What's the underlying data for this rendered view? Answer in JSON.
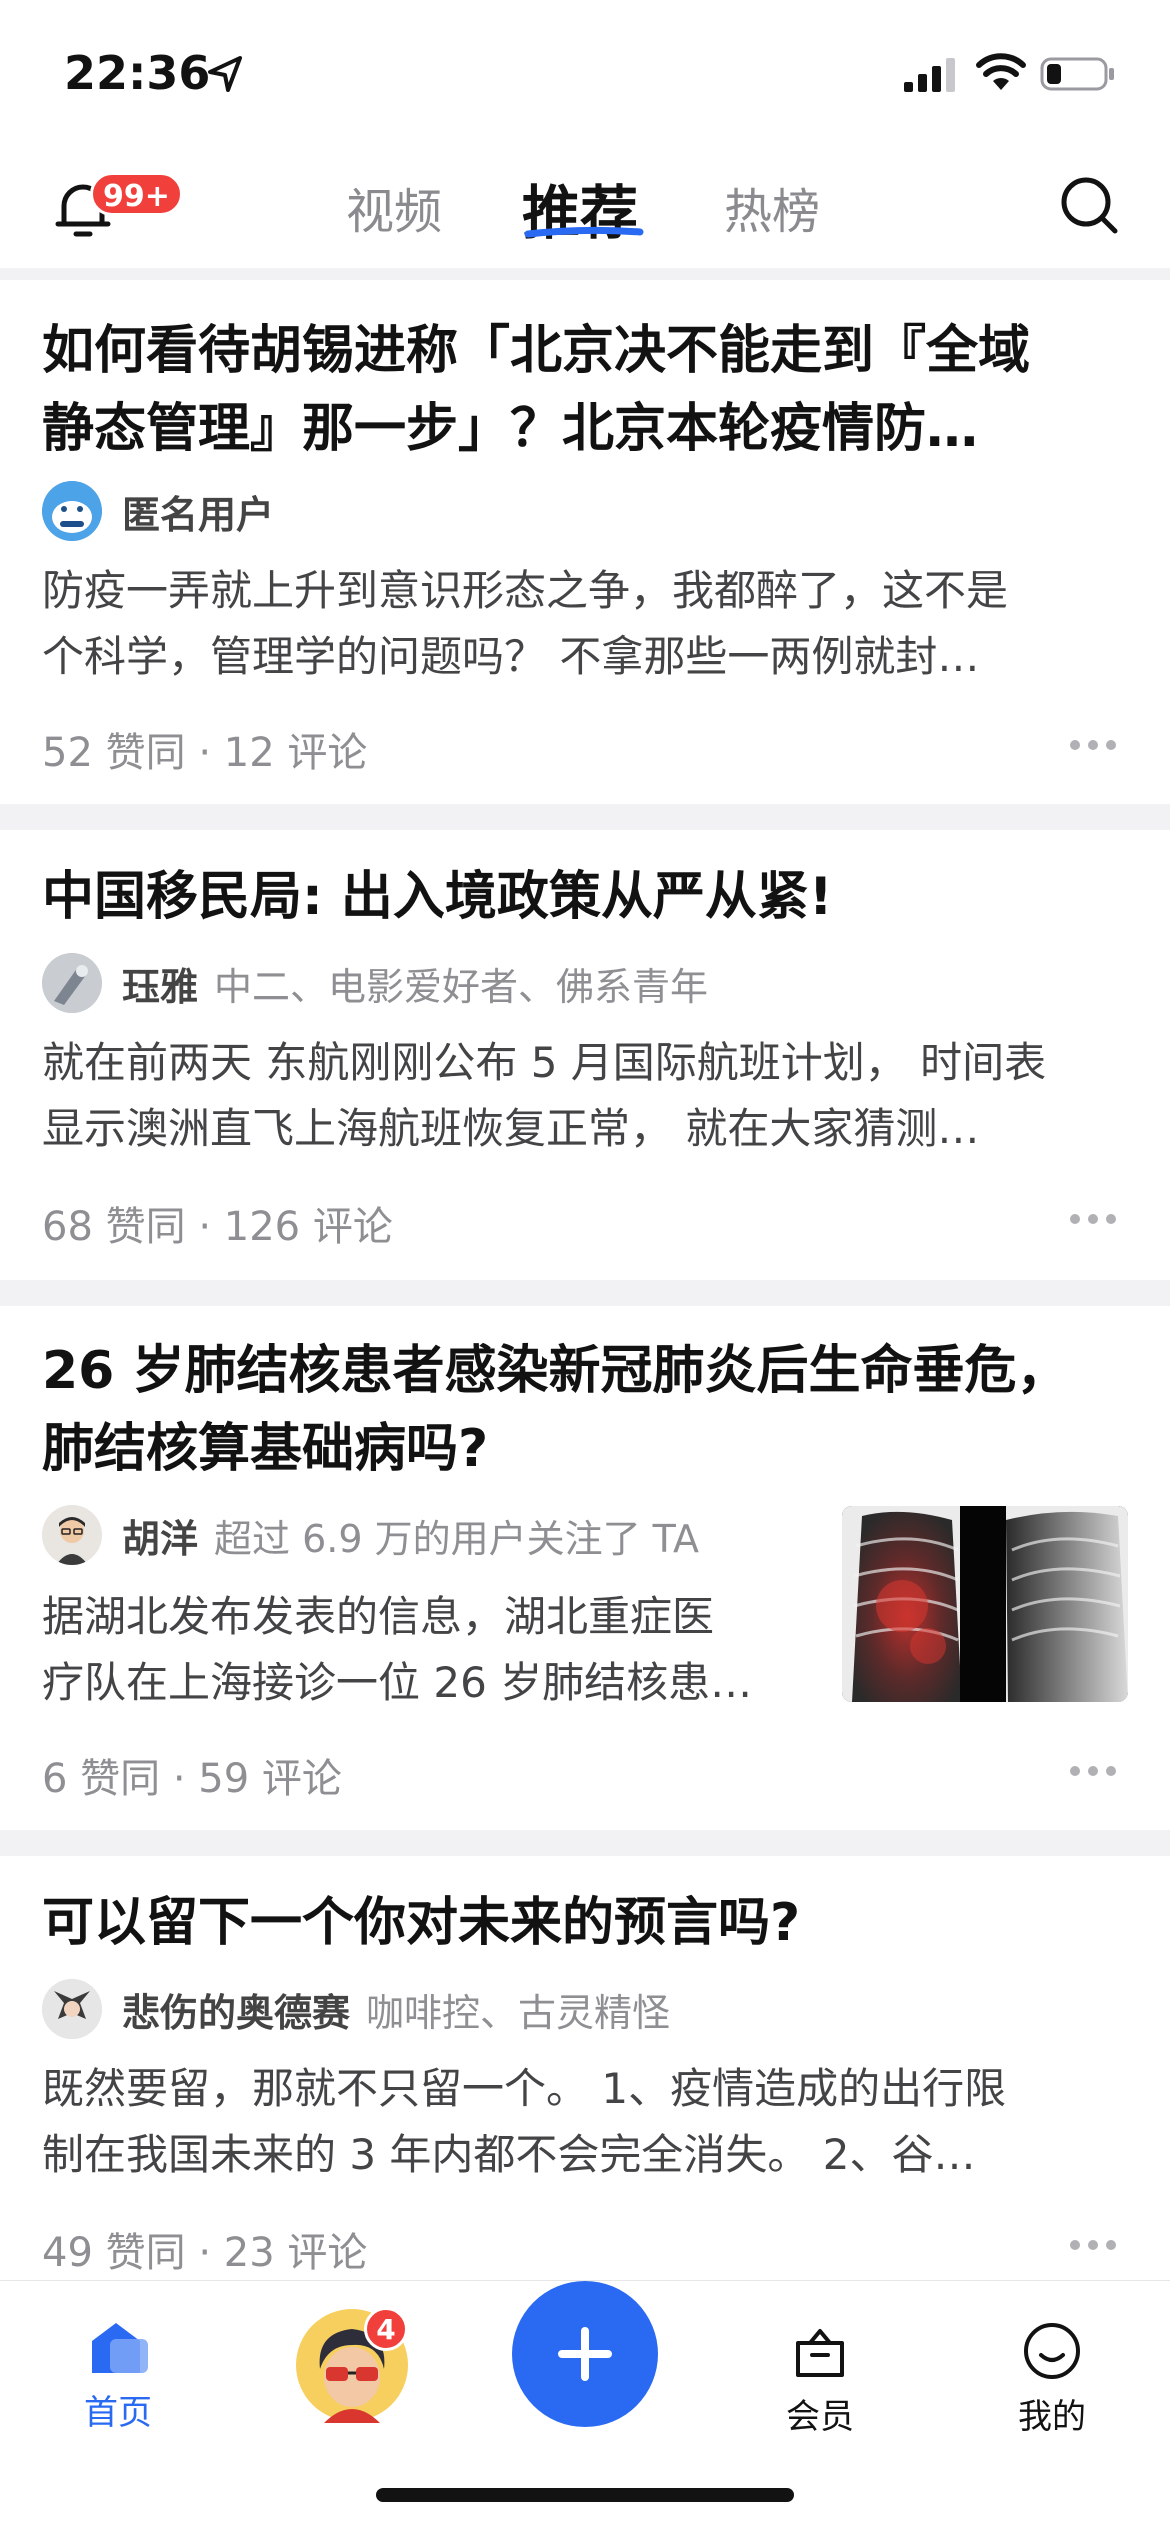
{
  "status_bar": {
    "time": "22:36"
  },
  "header": {
    "notification_badge": "99+",
    "tabs": [
      {
        "label": "视频",
        "active": false
      },
      {
        "label": "推荐",
        "active": true
      },
      {
        "label": "热榜",
        "active": false
      }
    ]
  },
  "feed": [
    {
      "title": "如何看待胡锡进称「北京决不能走到『全域静态管理』那一步」？北京本轮疫情防…",
      "title_line1": "如何看待胡锡进称「北京决不能走到『全域",
      "title_line2": "静态管理』那一步」？北京本轮疫情防…",
      "author": "匿名用户",
      "author_desc": "",
      "excerpt_line1": "防疫一弄就上升到意识形态之争，我都醉了，这不是",
      "excerpt_line2": "个科学，管理学的问题吗？ 不拿那些一两例就封…",
      "meta": "52 赞同 · 12 评论"
    },
    {
      "title_line1": "中国移民局: 出入境政策从严从紧!",
      "author": "珏雅",
      "author_desc": "中二、电影爱好者、佛系青年",
      "excerpt_line1": "就在前两天 东航刚刚公布 5 月国际航班计划， 时间表",
      "excerpt_line2": "显示澳洲直飞上海航班恢复正常， 就在大家猜测…",
      "meta": "68 赞同 · 126 评论"
    },
    {
      "title_line1": "26 岁肺结核患者感染新冠肺炎后生命垂危，",
      "title_line2": "肺结核算基础病吗?",
      "author": "胡洋",
      "author_desc": "超过 6.9 万的用户关注了 TA",
      "excerpt_line1": "据湖北发布发表的信息，湖北重症医",
      "excerpt_line2": "疗队在上海接诊一位 26 岁肺结核患…",
      "meta": "6 赞同 · 59 评论"
    },
    {
      "title_line1": "可以留下一个你对未来的预言吗?",
      "author": "悲伤的奥德赛",
      "author_desc": "咖啡控、古灵精怪",
      "excerpt_line1": "既然要留，那就不只留一个。 1、疫情造成的出行限",
      "excerpt_line2": "制在我国未来的 3 年内都不会完全消失。 2、谷…",
      "meta": "49 赞同 · 23 评论"
    }
  ],
  "tabbar": {
    "home_label": "首页",
    "avatar_badge": "4",
    "member_label": "会员",
    "mine_label": "我的"
  },
  "colors": {
    "accent": "#2a6af3",
    "badge": "#f1403c"
  }
}
